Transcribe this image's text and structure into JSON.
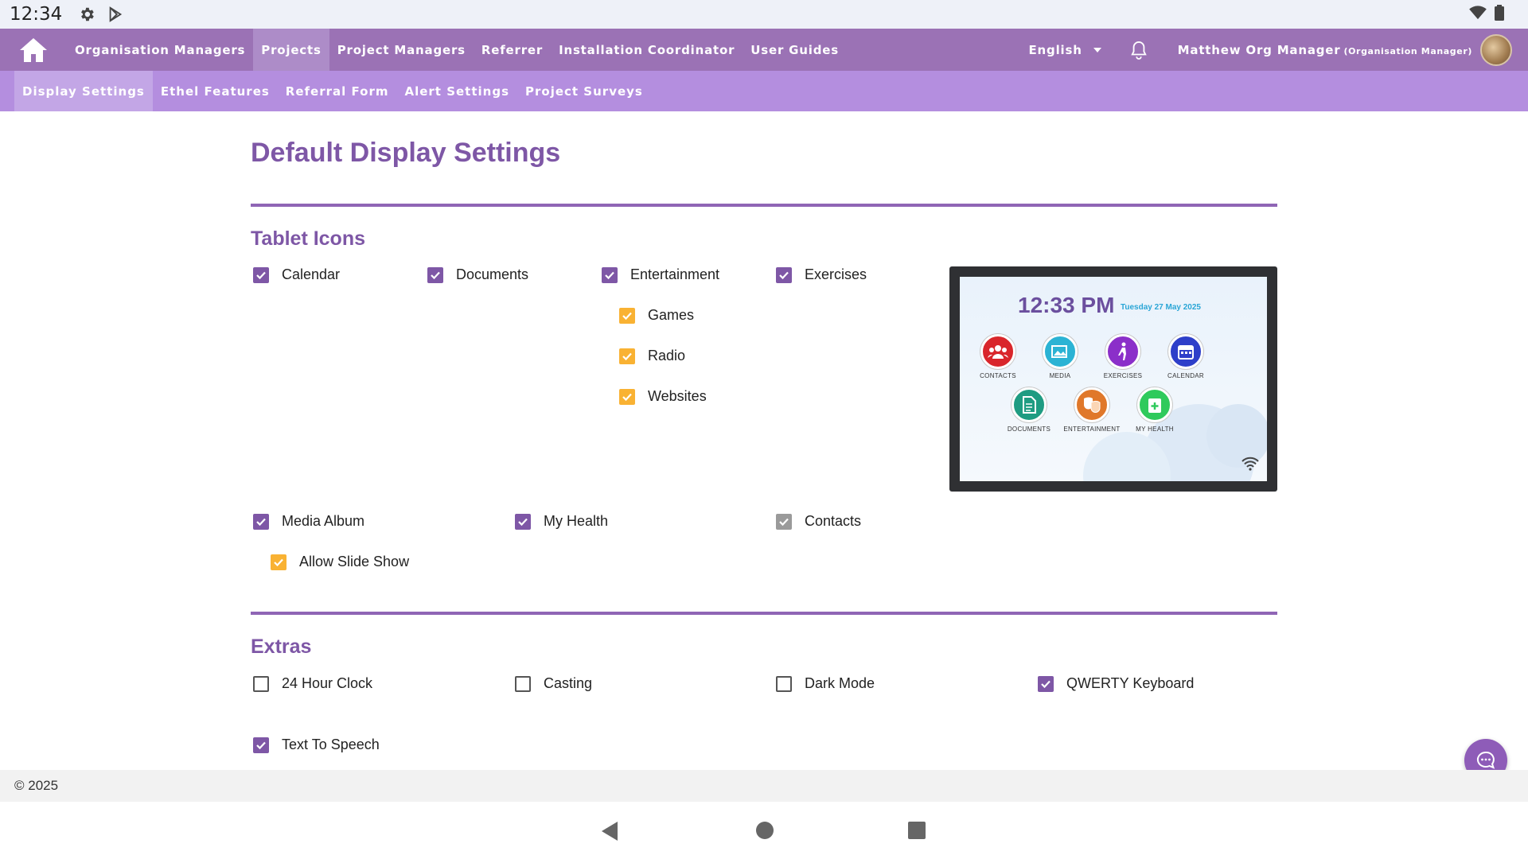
{
  "status_bar": {
    "time": "12:34"
  },
  "top_nav": {
    "items": [
      "Organisation Managers",
      "Projects",
      "Project Managers",
      "Referrer",
      "Installation Coordinator",
      "User Guides"
    ],
    "active_index": 1,
    "language": "English",
    "user_name": "Matthew Org Manager",
    "user_role": "(Organisation Manager)"
  },
  "sub_nav": {
    "items": [
      "Display Settings",
      "Ethel Features",
      "Referral Form",
      "Alert Settings",
      "Project Surveys"
    ],
    "active_index": 0
  },
  "page": {
    "title": "Default Display Settings",
    "tablet_icons_title": "Tablet Icons",
    "extras_title": "Extras"
  },
  "tablet_icons": {
    "calendar": {
      "label": "Calendar",
      "checked": true
    },
    "documents": {
      "label": "Documents",
      "checked": true
    },
    "entertainment": {
      "label": "Entertainment",
      "checked": true
    },
    "exercises": {
      "label": "Exercises",
      "checked": true
    },
    "games": {
      "label": "Games",
      "checked": true
    },
    "radio": {
      "label": "Radio",
      "checked": true
    },
    "websites": {
      "label": "Websites",
      "checked": true
    },
    "media_album": {
      "label": "Media Album",
      "checked": true
    },
    "allow_slide_show": {
      "label": "Allow Slide Show",
      "checked": true
    },
    "my_health": {
      "label": "My Health",
      "checked": true
    },
    "contacts": {
      "label": "Contacts",
      "checked": true,
      "disabled": true
    }
  },
  "extras": {
    "clock_24h": {
      "label": "24 Hour Clock",
      "checked": false
    },
    "casting": {
      "label": "Casting",
      "checked": false
    },
    "dark_mode": {
      "label": "Dark Mode",
      "checked": false
    },
    "qwerty": {
      "label": "QWERTY Keyboard",
      "checked": true
    },
    "tts": {
      "label": "Text To Speech",
      "checked": true
    }
  },
  "tablet_preview": {
    "time": "12:33 PM",
    "date": "Tuesday  27 May 2025",
    "apps": [
      "CONTACTS",
      "MEDIA",
      "EXERCISES",
      "CALENDAR",
      "DOCUMENTS",
      "ENTERTAINMENT",
      "MY HEALTH"
    ],
    "app_colors": [
      "#d9262b",
      "#2bb3d4",
      "#8b2fc9",
      "#2e3fc9",
      "#1f9c82",
      "#e0782a",
      "#2fca5c"
    ]
  },
  "footer": {
    "text": "© 2025"
  },
  "colors": {
    "nav": "#9b72b5",
    "subnav": "#b48edf",
    "accent": "#7e57a6",
    "orange": "#f9b233"
  }
}
